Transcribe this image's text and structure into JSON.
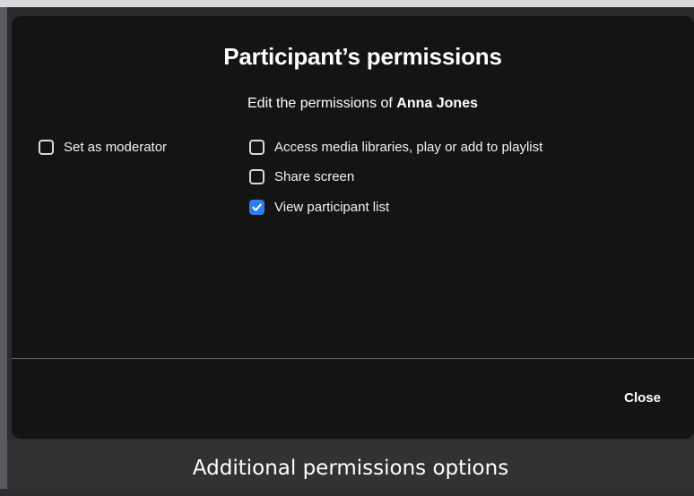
{
  "dialog": {
    "title": "Participant’s permissions",
    "subtitle_prefix": "Edit the permissions of ",
    "participant_name": "Anna Jones",
    "close_label": "Close"
  },
  "permissions": {
    "moderator": {
      "label": "Set as moderator",
      "checked": false
    },
    "media_libraries": {
      "label": "Access media libraries, play or add to playlist",
      "checked": false
    },
    "share_screen": {
      "label": "Share screen",
      "checked": false
    },
    "view_participant_list": {
      "label": "View participant list",
      "checked": true
    }
  },
  "caption": "Additional permissions options",
  "colors": {
    "dialog_background": "#141414",
    "checkbox_checked": "#2f7dea",
    "caption_background": "#323234"
  }
}
